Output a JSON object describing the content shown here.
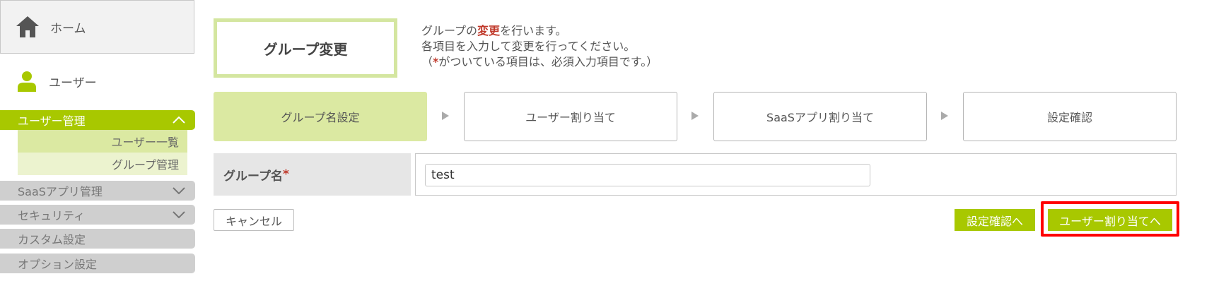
{
  "sidebar": {
    "home_label": "ホーム",
    "user_label": "ユーザー",
    "menus": [
      {
        "label": "ユーザー管理",
        "expanded": true,
        "chevron": "chevron-up-icon"
      },
      {
        "label": "SaaSアプリ管理",
        "chevron": "chevron-down-icon"
      },
      {
        "label": "セキュリティ",
        "chevron": "chevron-down-icon"
      },
      {
        "label": "カスタム設定"
      },
      {
        "label": "オプション設定"
      }
    ],
    "submenu": [
      {
        "label": "ユーザー一覧"
      },
      {
        "label": "グループ管理"
      }
    ]
  },
  "header": {
    "title": "グループ変更",
    "desc_prefix": "グループの",
    "desc_red": "変更",
    "desc_suffix": "を行います。",
    "desc_line2": "各項目を入力して変更を行ってください。",
    "desc_line3_open": "（",
    "desc_line3_star": "*",
    "desc_line3_rest": "がついている項目は、必須入力項目です。）"
  },
  "steps": [
    {
      "label": "グループ名設定",
      "active": true
    },
    {
      "label": "ユーザー割り当て"
    },
    {
      "label": "SaaSアプリ割り当て"
    },
    {
      "label": "設定確認"
    }
  ],
  "form": {
    "group_name_label": "グループ名",
    "required_mark": "*",
    "group_name_value": "test"
  },
  "buttons": {
    "cancel": "キャンセル",
    "confirm": "設定確認へ",
    "assign_users": "ユーザー割り当てへ"
  },
  "colors": {
    "accent": "#a8c800",
    "accent_light": "#dbe9a2",
    "highlight": "#ff0000",
    "required": "#c0392b"
  }
}
